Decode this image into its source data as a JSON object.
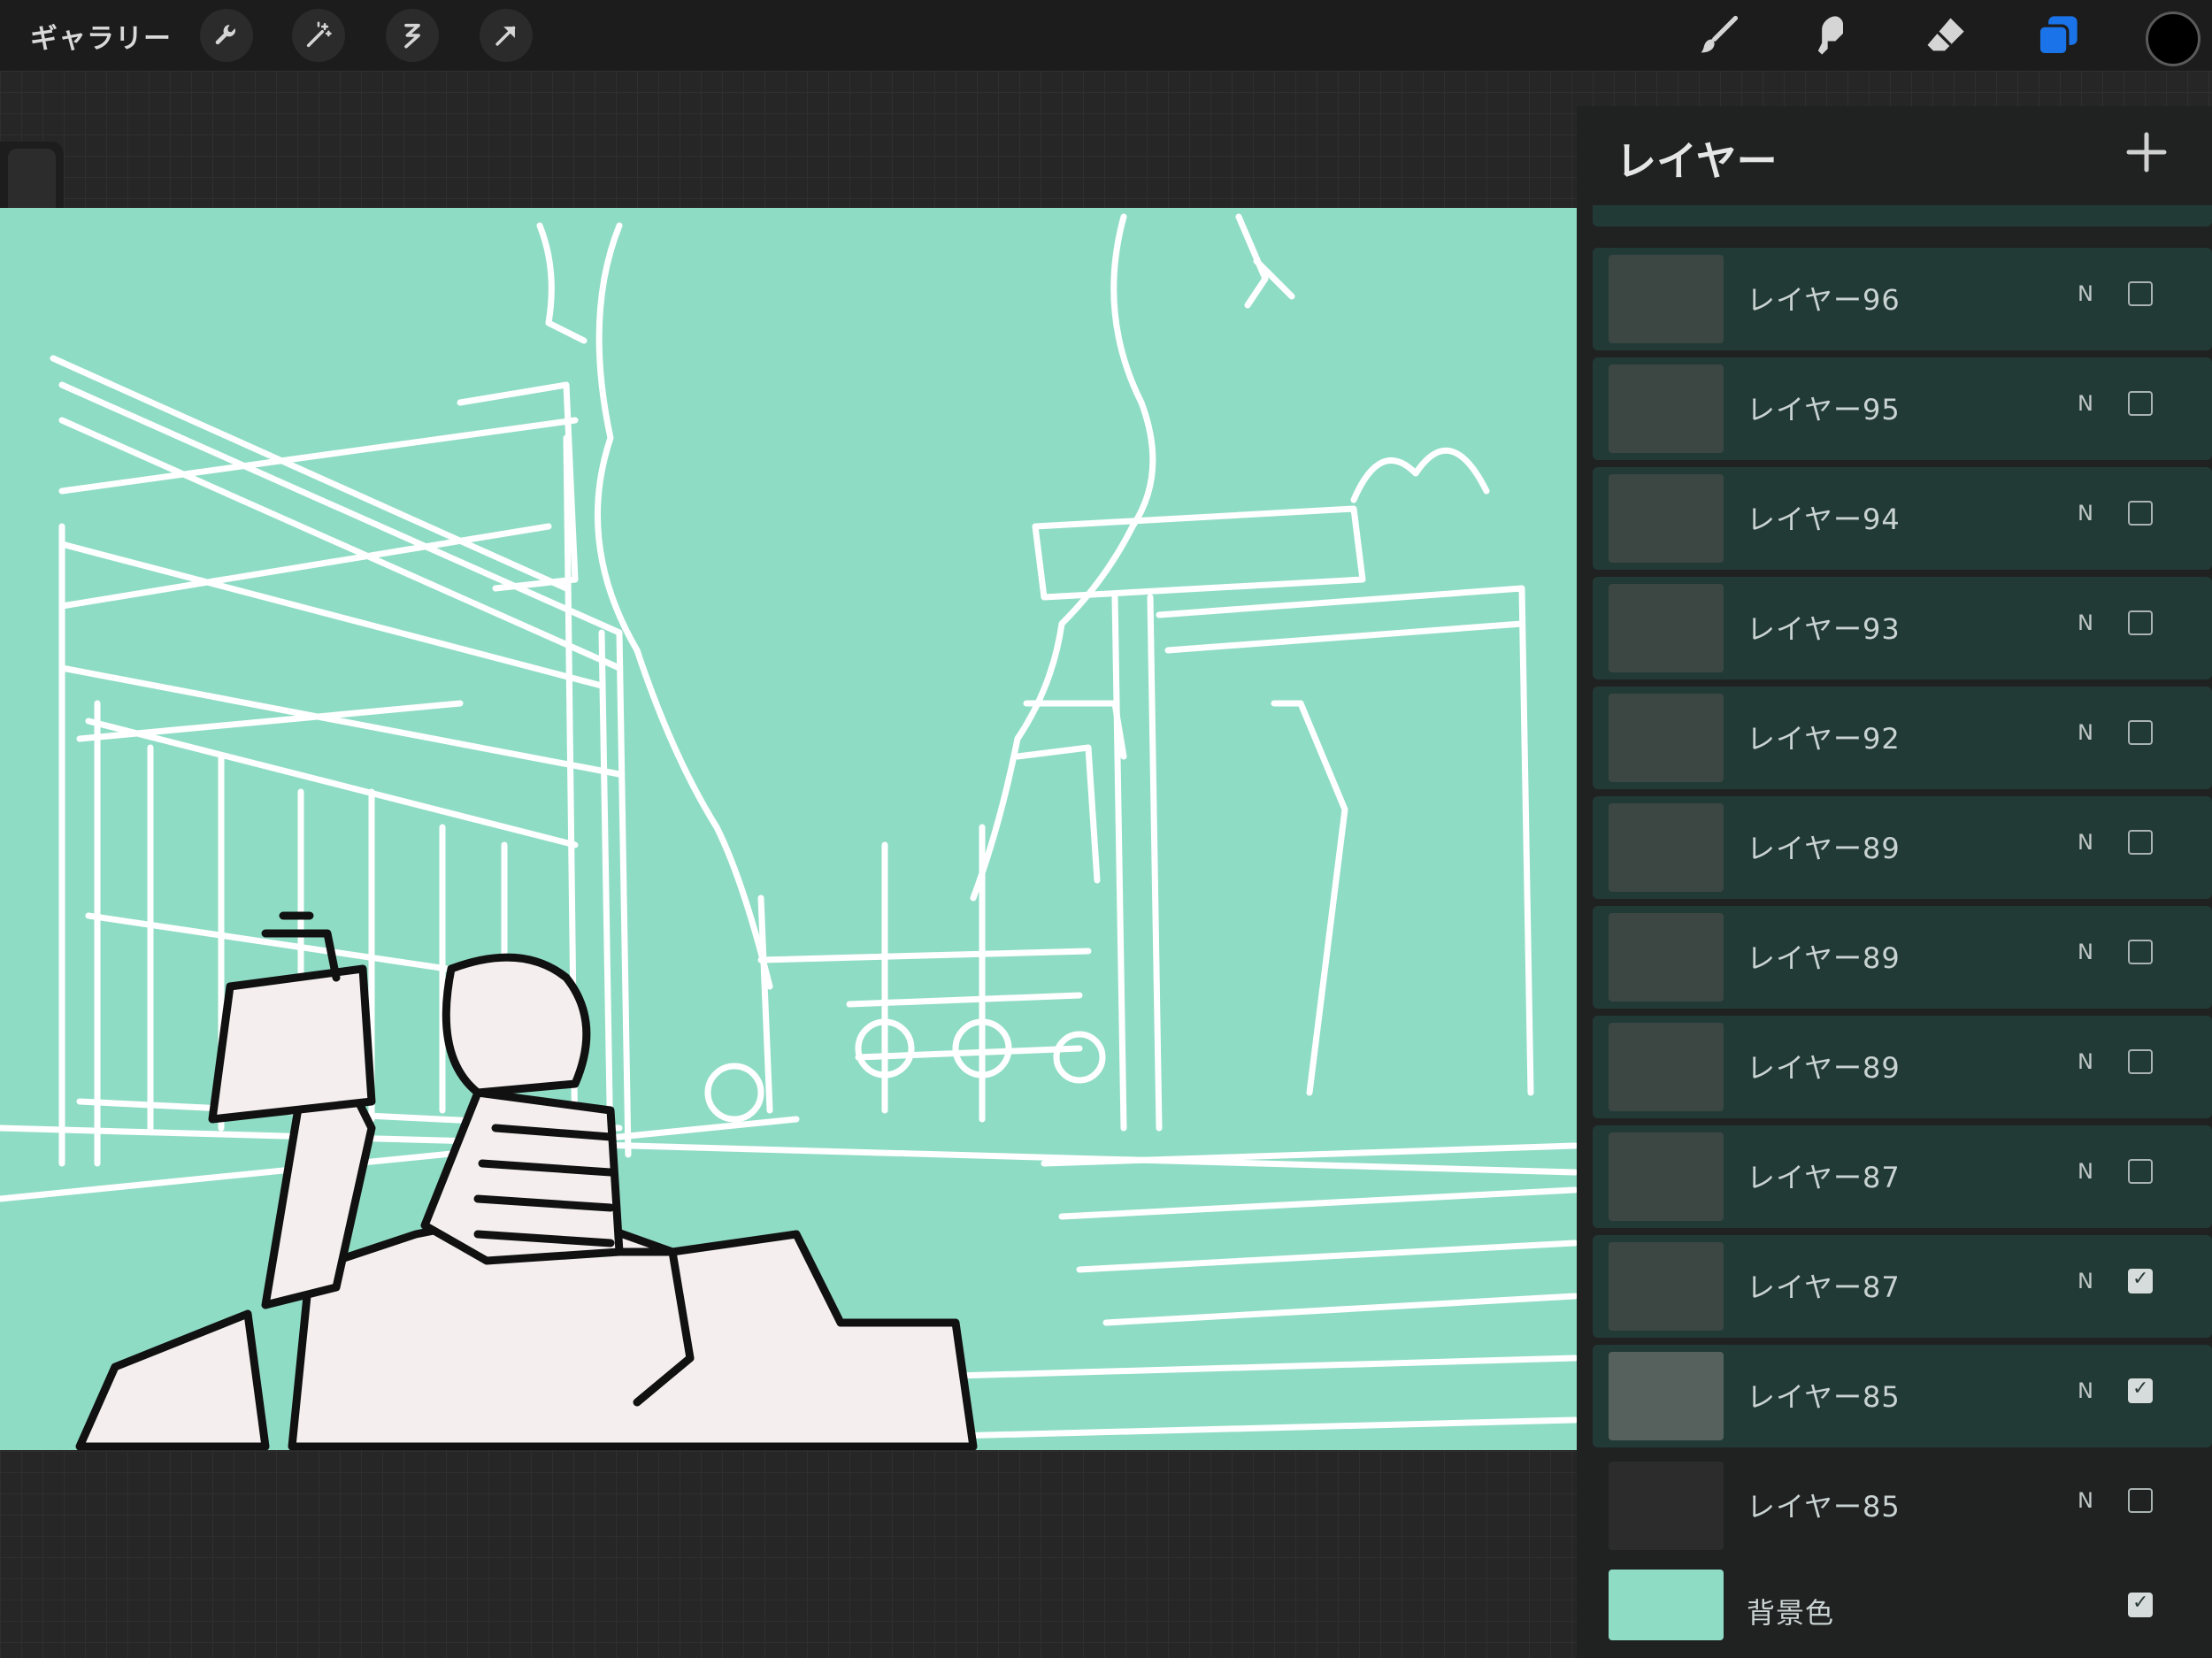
{
  "topbar": {
    "gallery_label": "ギャラリー",
    "tools_left": [
      "wrench-icon",
      "magic-wand-icon",
      "selection-icon",
      "transform-arrow-icon"
    ],
    "tools_right": [
      "brush-icon",
      "smudge-icon",
      "eraser-icon",
      "layers-icon"
    ]
  },
  "colors": {
    "canvas_bg": "#8fdcc5",
    "accent": "#1a73e8",
    "current_color": "#000000"
  },
  "layers_panel": {
    "title": "レイヤー",
    "layers": [
      {
        "name": "レイヤー96",
        "blend": "N",
        "visible": false
      },
      {
        "name": "レイヤー95",
        "blend": "N",
        "visible": false
      },
      {
        "name": "レイヤー94",
        "blend": "N",
        "visible": false
      },
      {
        "name": "レイヤー93",
        "blend": "N",
        "visible": false
      },
      {
        "name": "レイヤー92",
        "blend": "N",
        "visible": false
      },
      {
        "name": "レイヤー89",
        "blend": "N",
        "visible": false
      },
      {
        "name": "レイヤー89",
        "blend": "N",
        "visible": false
      },
      {
        "name": "レイヤー89",
        "blend": "N",
        "visible": false
      },
      {
        "name": "レイヤー87",
        "blend": "N",
        "visible": false
      },
      {
        "name": "レイヤー87",
        "blend": "N",
        "visible": true
      },
      {
        "name": "レイヤー85",
        "blend": "N",
        "visible": true
      },
      {
        "name": "レイヤー85",
        "blend": "N",
        "visible": false
      }
    ],
    "background": {
      "name": "背景色",
      "visible": true
    }
  }
}
